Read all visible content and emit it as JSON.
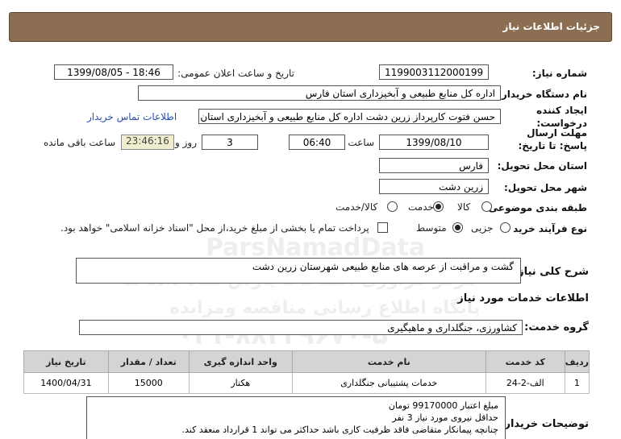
{
  "header": {
    "title": "جزئیات اطلاعات نیاز"
  },
  "fields": {
    "need_number_label": "شماره نیاز:",
    "need_number": "1199003112000199",
    "announce_label": "تاریخ و ساعت اعلان عمومی:",
    "announce_value": "1399/08/05 - 18:46",
    "buyer_label": "نام دستگاه خریدار:",
    "buyer_value": "اداره کل منابع طبیعی و آبخیزداری استان فارس",
    "creator_label": "ایجاد کننده درخواست:",
    "creator_value": "حسن فتوت کارپرداز زرین دشت اداره کل منابع طبیعی و آبخیزداری استان فارس",
    "contact_link": "اطلاعات تماس خریدار",
    "deadline_label": "مهلت ارسال پاسخ: تا تاریخ:",
    "deadline_date": "1399/08/10",
    "time_label": "ساعت",
    "deadline_time": "06:40",
    "days_value": "3",
    "days_label": "روز و",
    "remaining_time": "23:46:16",
    "remaining_label": "ساعت باقی مانده",
    "province_label": "استان محل تحویل:",
    "province_value": "فارس",
    "city_label": "شهر محل تحویل:",
    "city_value": "زرین دشت",
    "category_label": "طبقه بندی موضوعی:",
    "category_options": [
      "کالا",
      "خدمت",
      "کالا/خدمت"
    ],
    "category_selected": 1,
    "process_label": "نوع فرآیند خرید :",
    "process_options": [
      "جزیی",
      "متوسط"
    ],
    "process_selected": 1,
    "payment_note": "پرداخت تمام یا بخشی از مبلغ خرید،از محل \"اسناد خزانه اسلامی\" خواهد بود."
  },
  "summary": {
    "label": "شرح کلی نیاز:",
    "value": "گشت و مراقبت از عرصه های منابع طبیعی شهرستان زرین دشت"
  },
  "services_section": {
    "title": "اطلاعات خدمات مورد نیاز",
    "group_label": "گروه خدمت:",
    "group_value": "کشاورزی، جنگلداری و ماهیگیری"
  },
  "table": {
    "headers": [
      "ردیف",
      "کد خدمت",
      "نام خدمت",
      "واحد اندازه گیری",
      "تعداد / مقدار",
      "تاریخ نیاز"
    ],
    "rows": [
      [
        "1",
        "الف-2-24",
        "خدمات پشتیبانی جنگلداری",
        "هکتار",
        "15000",
        "1400/04/31"
      ]
    ]
  },
  "buyer_notes": {
    "label": "توضیحات خریدار:",
    "lines": [
      "مبلغ اعتبار 99170000 تومان",
      "حداقل نیروی مورد نیاز 3 نفر",
      "چنانچه پیمانکار متقاضی فاقد ظرفیت کاری باشد حداکثر می تواند 1 قرارداد منعقد کند."
    ]
  },
  "watermark": {
    "brand": "ParsNamadData",
    "line1": "مرکز فراوری اطلاعات پارس نماد داده ها",
    "line2": "پایگاه اطلاع رسانی مناقصه ومزایده",
    "phone": "۰۲۱-۸۸۳۴۹۶۷۰-۵"
  },
  "colors": {
    "titlebar": "#8c6e52",
    "timer_bg": "#efefd0",
    "link": "#2a4fa6"
  }
}
